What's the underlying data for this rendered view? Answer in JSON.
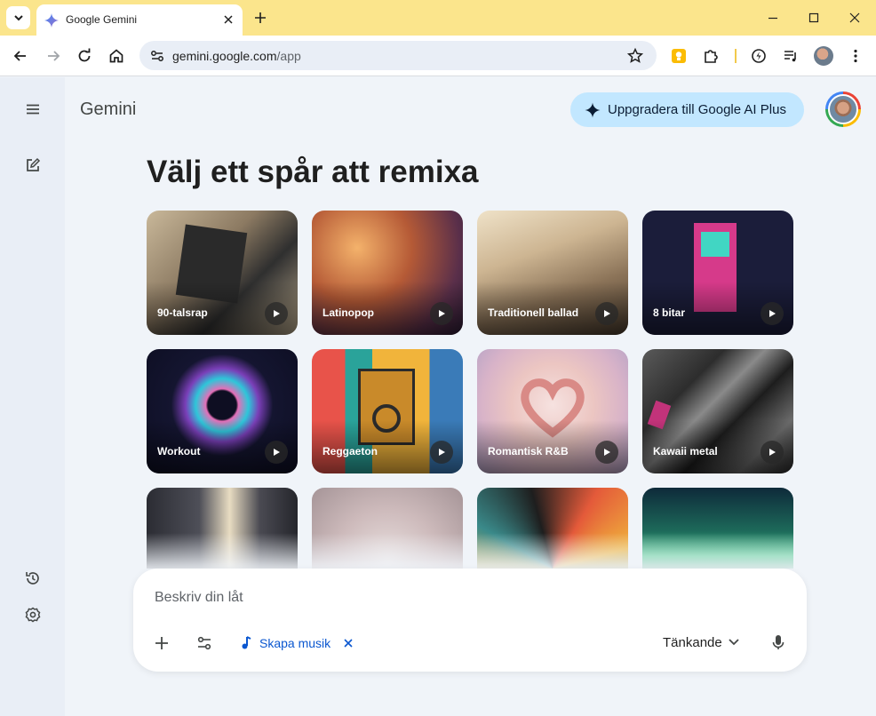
{
  "browser": {
    "tab_title": "Google Gemini",
    "url_host": "gemini.google.com",
    "url_path": "/app",
    "chrome_color": "#fbe58c"
  },
  "app": {
    "brand": "Gemini",
    "upgrade_label": "Uppgradera till Google AI Plus",
    "heading": "Välj ett spår att remixa",
    "accent": "#0b57d0"
  },
  "tracks": [
    {
      "label": "90-talsrap",
      "icon": "play-icon"
    },
    {
      "label": "Latinopop",
      "icon": "play-icon"
    },
    {
      "label": "Traditionell ballad",
      "icon": "play-icon"
    },
    {
      "label": "8 bitar",
      "icon": "play-icon"
    },
    {
      "label": "Workout",
      "icon": "play-icon"
    },
    {
      "label": "Reggaeton",
      "icon": "play-icon"
    },
    {
      "label": "Romantisk R&B",
      "icon": "play-icon"
    },
    {
      "label": "Kawaii metal",
      "icon": "play-icon"
    },
    {
      "label": ""
    },
    {
      "label": ""
    },
    {
      "label": ""
    },
    {
      "label": ""
    }
  ],
  "prompt": {
    "placeholder": "Beskriv din låt",
    "chip_label": "Skapa musik",
    "mode_label": "Tänkande"
  }
}
